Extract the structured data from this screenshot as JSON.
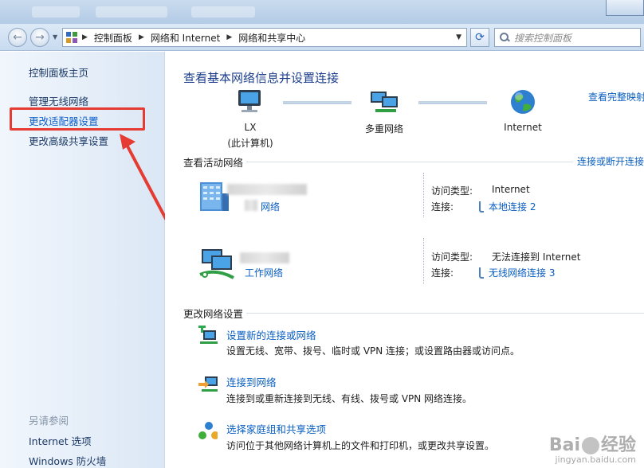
{
  "breadcrumb": [
    "控制面板",
    "网络和 Internet",
    "网络和共享中心"
  ],
  "search": {
    "placeholder": "搜索控制面板"
  },
  "sidebar": {
    "items": [
      {
        "label": "控制面板主页"
      },
      {
        "label": "管理无线网络"
      },
      {
        "label": "更改适配器设置"
      },
      {
        "label": "更改高级共享设置"
      }
    ],
    "see_also_heading": "另请参阅",
    "see_also": [
      {
        "label": "Internet 选项"
      },
      {
        "label": "Windows 防火墙"
      }
    ]
  },
  "main": {
    "title": "查看基本网络信息并设置连接",
    "see_full_map": "查看完整映射",
    "map": {
      "this_pc_name": "LX",
      "this_pc_sub": "(此计算机)",
      "middle": "多重网络",
      "internet": "Internet"
    },
    "active_networks": {
      "heading": "查看活动网络",
      "connect_link": "连接或断开连接",
      "networks": [
        {
          "name_visible": "网络",
          "access_type_label": "访问类型:",
          "access_type_value": "Internet",
          "connection_label": "连接:",
          "connection_value": "本地连接 2"
        },
        {
          "name_visible": "工作网络",
          "access_type_label": "访问类型:",
          "access_type_value": "无法连接到 Internet",
          "connection_label": "连接:",
          "connection_value": "无线网络连接 3"
        }
      ]
    },
    "change_settings": {
      "heading": "更改网络设置",
      "tasks": [
        {
          "title": "设置新的连接或网络",
          "desc": "设置无线、宽带、拨号、临时或 VPN 连接；或设置路由器或访问点。",
          "icon": "new-connection-icon"
        },
        {
          "title": "连接到网络",
          "desc": "连接到或重新连接到无线、有线、拨号或 VPN 网络连接。",
          "icon": "connect-network-icon"
        },
        {
          "title": "选择家庭组和共享选项",
          "desc": "访问位于其他网络计算机上的文件和打印机，或更改共享设置。",
          "icon": "homegroup-icon"
        }
      ]
    }
  },
  "watermark": {
    "brand_left": "Bai",
    "brand_right": "经验",
    "url": "jingyan.baidu.com"
  },
  "colors": {
    "link": "#0a5fc2",
    "title": "#1e3f8c",
    "highlight": "#e53b32"
  }
}
